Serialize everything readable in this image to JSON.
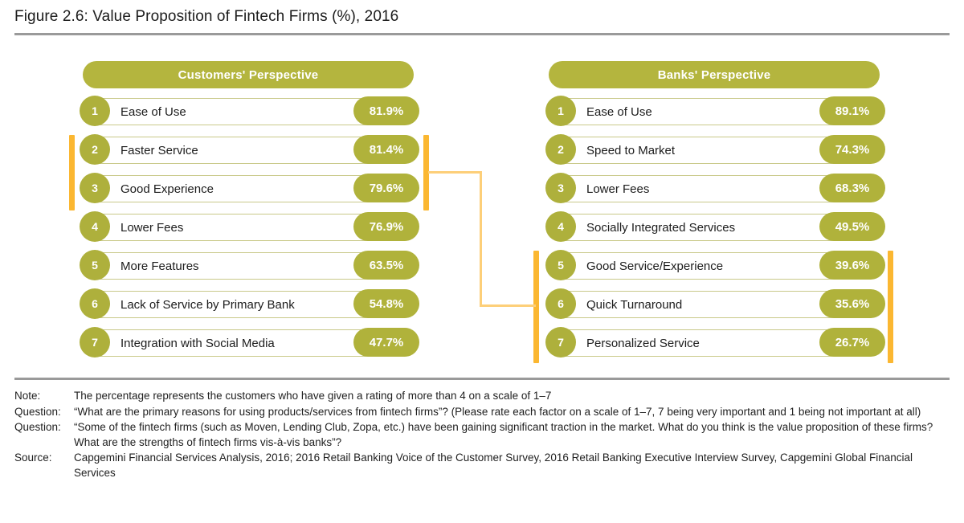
{
  "figure": {
    "title": "Figure 2.6: Value Proposition of Fintech Firms (%), 2016"
  },
  "colors": {
    "green_header": "#b4b53e",
    "green_badge": "#aeb03c",
    "green_value_pill": "#b0b23b",
    "row_border": "#c9c98a",
    "orange_bracket": "#fbb731",
    "orange_connector": "#fdcf79",
    "rule": "#9a9a9a"
  },
  "chart_data": {
    "type": "bar",
    "title": "Figure 2.6: Value Proposition of Fintech Firms (%), 2016",
    "xlabel": "",
    "ylabel": "",
    "unit": "%",
    "series": [
      {
        "name": "Customers' Perspective",
        "categories": [
          "Ease of Use",
          "Faster Service",
          "Good Experience",
          "Lower Fees",
          "More Features",
          "Lack of Service by Primary Bank",
          "Integration with Social Media"
        ],
        "values": [
          81.9,
          81.4,
          79.6,
          76.9,
          63.5,
          54.8,
          47.7
        ]
      },
      {
        "name": "Banks' Perspective",
        "categories": [
          "Ease of Use",
          "Speed to Market",
          "Lower Fees",
          "Socially Integrated Services",
          "Good Service/Experience",
          "Quick Turnaround",
          "Personalized Service"
        ],
        "values": [
          89.1,
          74.3,
          68.3,
          49.5,
          39.6,
          35.6,
          26.7
        ]
      }
    ],
    "annotations": [
      "Orange bracket highlights Customers' Perspective ranks 2-3 (Faster Service, Good Experience)",
      "Orange connector links Customers' ranks 2-3 to Banks' ranks 5-7",
      "Orange brackets highlight Banks' Perspective ranks 5-7 (Good Service/Experience, Quick Turnaround, Personalized Service)"
    ]
  },
  "columns": [
    {
      "header": "Customers' Perspective",
      "rows": [
        {
          "rank": "1",
          "label": "Ease of Use",
          "value": "81.9%"
        },
        {
          "rank": "2",
          "label": "Faster Service",
          "value": "81.4%"
        },
        {
          "rank": "3",
          "label": "Good Experience",
          "value": "79.6%"
        },
        {
          "rank": "4",
          "label": "Lower Fees",
          "value": "76.9%"
        },
        {
          "rank": "5",
          "label": "More Features",
          "value": "63.5%"
        },
        {
          "rank": "6",
          "label": "Lack of Service by Primary Bank",
          "value": "54.8%"
        },
        {
          "rank": "7",
          "label": "Integration with Social Media",
          "value": "47.7%"
        }
      ]
    },
    {
      "header": "Banks' Perspective",
      "rows": [
        {
          "rank": "1",
          "label": "Ease of Use",
          "value": "89.1%"
        },
        {
          "rank": "2",
          "label": "Speed to Market",
          "value": "74.3%"
        },
        {
          "rank": "3",
          "label": "Lower Fees",
          "value": "68.3%"
        },
        {
          "rank": "4",
          "label": "Socially Integrated Services",
          "value": "49.5%"
        },
        {
          "rank": "5",
          "label": "Good Service/Experience",
          "value": "39.6%"
        },
        {
          "rank": "6",
          "label": "Quick Turnaround",
          "value": "35.6%"
        },
        {
          "rank": "7",
          "label": "Personalized Service",
          "value": "26.7%"
        }
      ]
    }
  ],
  "footnotes": [
    {
      "key": "Note:",
      "text": "The percentage represents the customers who have given a rating of more than 4 on a scale of 1–7"
    },
    {
      "key": "Question:",
      "text": "“What are the primary reasons for using products/services from fintech firms”? (Please rate each factor on a scale of 1–7, 7 being very important and 1 being not important at all)"
    },
    {
      "key": "Question:",
      "text": "“Some of the fintech firms (such as Moven, Lending Club, Zopa, etc.) have been gaining significant traction in the market. What do you think is the value proposition of these firms? What are the strengths of fintech firms vis-à-vis banks”?"
    },
    {
      "key": "Source:",
      "text": "Capgemini Financial Services Analysis, 2016; 2016 Retail Banking Voice of the Customer Survey, 2016 Retail Banking Executive Interview Survey, Capgemini Global Financial Services"
    }
  ]
}
